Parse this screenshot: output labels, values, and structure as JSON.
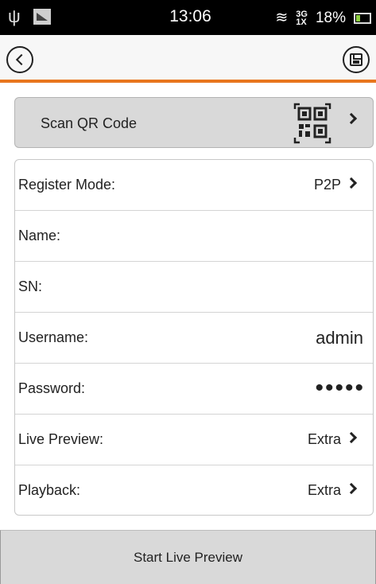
{
  "status_bar": {
    "time": "13:06",
    "network": "3G\n1X",
    "battery_percent": "18%",
    "battery_level": 0.18,
    "icons": [
      "usb-icon",
      "screenshot-icon",
      "wifi-icon",
      "signal-icon",
      "battery-icon"
    ]
  },
  "toolbar": {
    "back_icon": "chevron-left-icon",
    "save_icon": "floppy-save-icon"
  },
  "scan": {
    "label": "Scan QR Code",
    "icon": "qr-code-icon"
  },
  "form": {
    "rows": [
      {
        "label": "Register Mode:",
        "value": "P2P",
        "has_chevron": true
      },
      {
        "label": "Name:",
        "value": ""
      },
      {
        "label": "SN:",
        "value": ""
      },
      {
        "label": "Username:",
        "value": "admin"
      },
      {
        "label": "Password:",
        "value": "•••••"
      },
      {
        "label": "Live Preview:",
        "value": "Extra",
        "has_chevron": true
      },
      {
        "label": "Playback:",
        "value": "Extra",
        "has_chevron": true
      }
    ]
  },
  "bottom": {
    "start_label": "Start Live Preview"
  },
  "colors": {
    "accent": "#e8761e",
    "status_bar": "#000000",
    "button_bg": "#d9d9d9"
  }
}
